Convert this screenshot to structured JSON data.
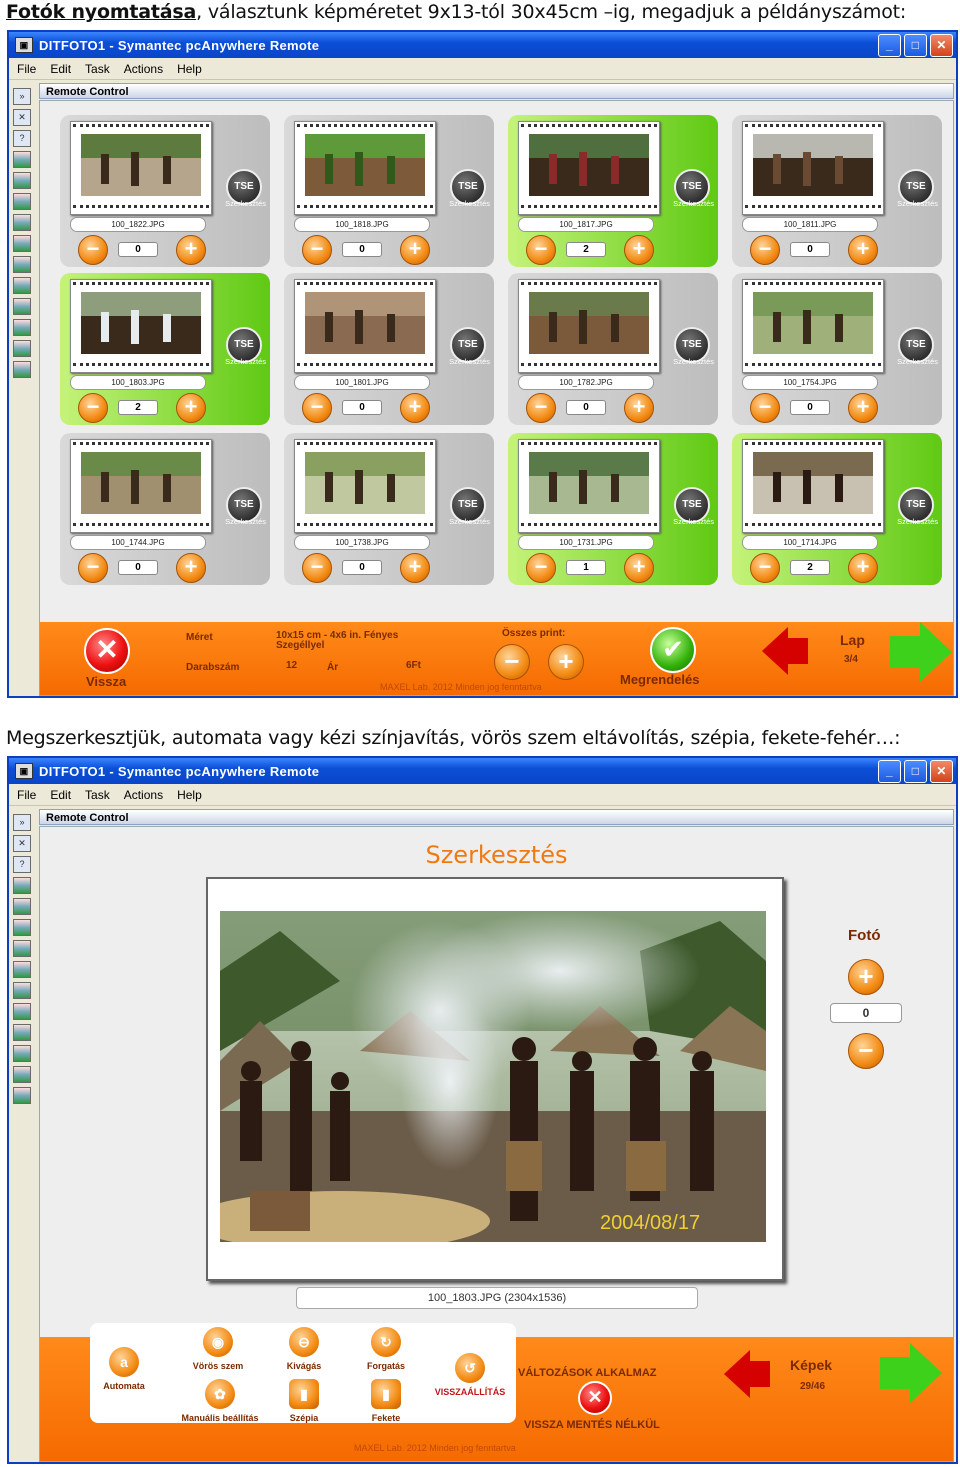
{
  "caption1": {
    "bold": "Fotók nyomtatása",
    "rest": ", választunk képméretet 9x13-tól 30x45cm –ig, megadjuk a példányszámot:"
  },
  "caption2": "Megszerkesztjük, automata vagy kézi színjavítás, vörös szem eltávolítás, szépia, fekete-fehér…:",
  "window": {
    "title": "DITFOTO1 - Symantec pcAnywhere Remote",
    "menu": [
      "File",
      "Edit",
      "Task",
      "Actions",
      "Help"
    ],
    "panel_title": "Remote Control",
    "btn_min": "_",
    "btn_max": "□",
    "btn_close": "✕"
  },
  "grid": {
    "edit_label": "Szerkesztés",
    "edit_icon": "TSE",
    "items": [
      {
        "file": "100_1822.JPG",
        "qty": "0",
        "selected": false,
        "photo": "camp-fire"
      },
      {
        "file": "100_1818.JPG",
        "qty": "0",
        "selected": false,
        "photo": "green-leaves"
      },
      {
        "file": "100_1817.JPG",
        "qty": "2",
        "selected": true,
        "photo": "group-red"
      },
      {
        "file": "100_1811.JPG",
        "qty": "0",
        "selected": false,
        "photo": "smoke-pile"
      },
      {
        "file": "100_1803.JPG",
        "qty": "2",
        "selected": true,
        "photo": "village-smoke"
      },
      {
        "file": "100_1801.JPG",
        "qty": "0",
        "selected": false,
        "photo": "person-crouch"
      },
      {
        "file": "100_1782.JPG",
        "qty": "0",
        "selected": false,
        "photo": "crowd"
      },
      {
        "file": "100_1754.JPG",
        "qty": "0",
        "selected": false,
        "photo": "field-group"
      },
      {
        "file": "100_1744.JPG",
        "qty": "0",
        "selected": false,
        "photo": "field-dance"
      },
      {
        "file": "100_1738.JPG",
        "qty": "0",
        "selected": false,
        "photo": "grass-line"
      },
      {
        "file": "100_1731.JPG",
        "qty": "1",
        "selected": true,
        "photo": "valley"
      },
      {
        "file": "100_1714.JPG",
        "qty": "2",
        "selected": true,
        "photo": "hut"
      }
    ]
  },
  "order_bar": {
    "back": "Vissza",
    "size_label": "Méret",
    "size_value": "10x15 cm - 4x6 in. Fényes Szegéllyel",
    "qty_label": "Darabszám",
    "qty_value": "12",
    "price_label": "Ár",
    "price_value": "6Ft",
    "total_label": "Összes print:",
    "order": "Megrendelés",
    "page_label": "Lap",
    "page_value": "3/4",
    "footer": "MAXEL Lab. 2012 Minden jog fenntartva"
  },
  "editor": {
    "title": "Szerkesztés",
    "photo_date": "2004/08/17",
    "file_info": "100_1803.JPG (2304x1536)",
    "foto_label": "Fotó",
    "foto_qty": "0",
    "tools": {
      "auto": "Automata",
      "redeye": "Vörös szem",
      "manual": "Manuális beállítás",
      "crop": "Kivágás",
      "sepia": "Szépia",
      "rotate": "Forgatás",
      "bw": "Fekete",
      "restore": "VISSZAÁLLÍTÁS"
    },
    "apply": "VÁLTOZÁSOK ALKALMAZ",
    "discard": "VISSZA MENTÉS NÉLKÜL",
    "images_label": "Képek",
    "images_value": "29/46",
    "footer": "MAXEL Lab. 2012 Minden jog fenntartva"
  }
}
